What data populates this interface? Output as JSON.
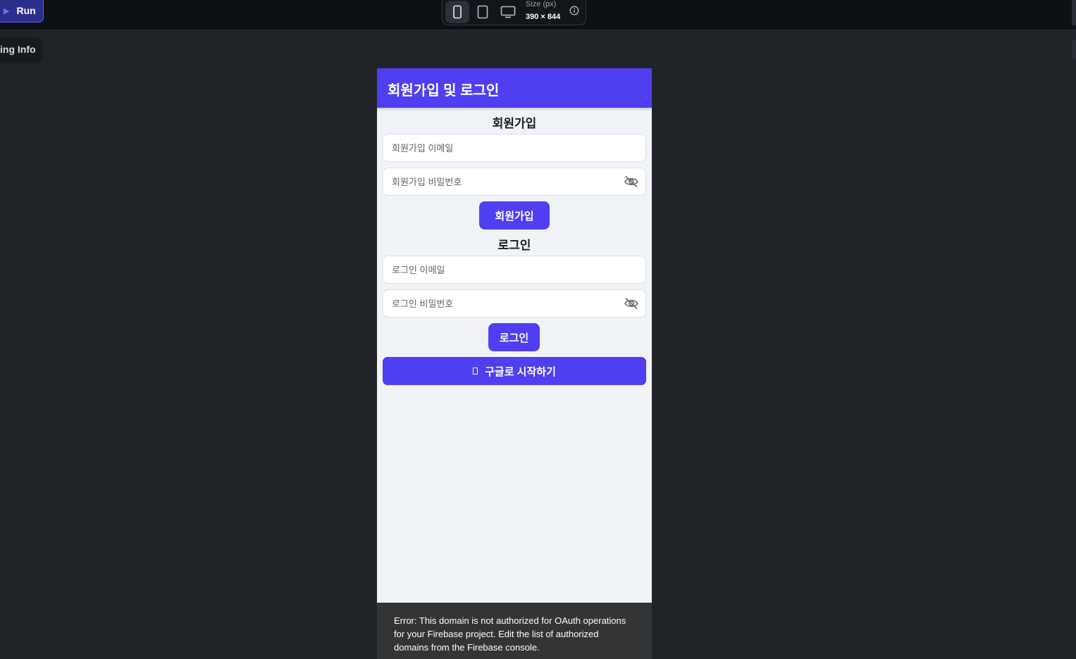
{
  "toolbar": {
    "run_label": "Run",
    "size_label": "Size (px)",
    "size_value": "390 × 844"
  },
  "side": {
    "tracking_label": "ing Info"
  },
  "app": {
    "title": "회원가입 및 로그인",
    "signup": {
      "heading": "회원가입",
      "email_placeholder": "회원가입 이메일",
      "password_placeholder": "회원가입 비밀번호",
      "button_label": "회원가입"
    },
    "login": {
      "heading": "로그인",
      "email_placeholder": "로그인 이메일",
      "password_placeholder": "로그인 비밀번호",
      "button_label": "로그인"
    },
    "google_button_label": "구글로 시작하기",
    "error_message": "Error: This domain is not authorized for OAuth operations for your Firebase project. Edit the list of authorized domains from the Firebase console."
  },
  "colors": {
    "accent": "#4f3ff0",
    "background": "#202428",
    "phone_background": "#f0f3f8"
  },
  "icons": [
    "play-icon",
    "phone-device-icon",
    "tablet-device-icon",
    "desktop-device-icon",
    "info-icon",
    "eye-slash-icon",
    "google-icon"
  ]
}
